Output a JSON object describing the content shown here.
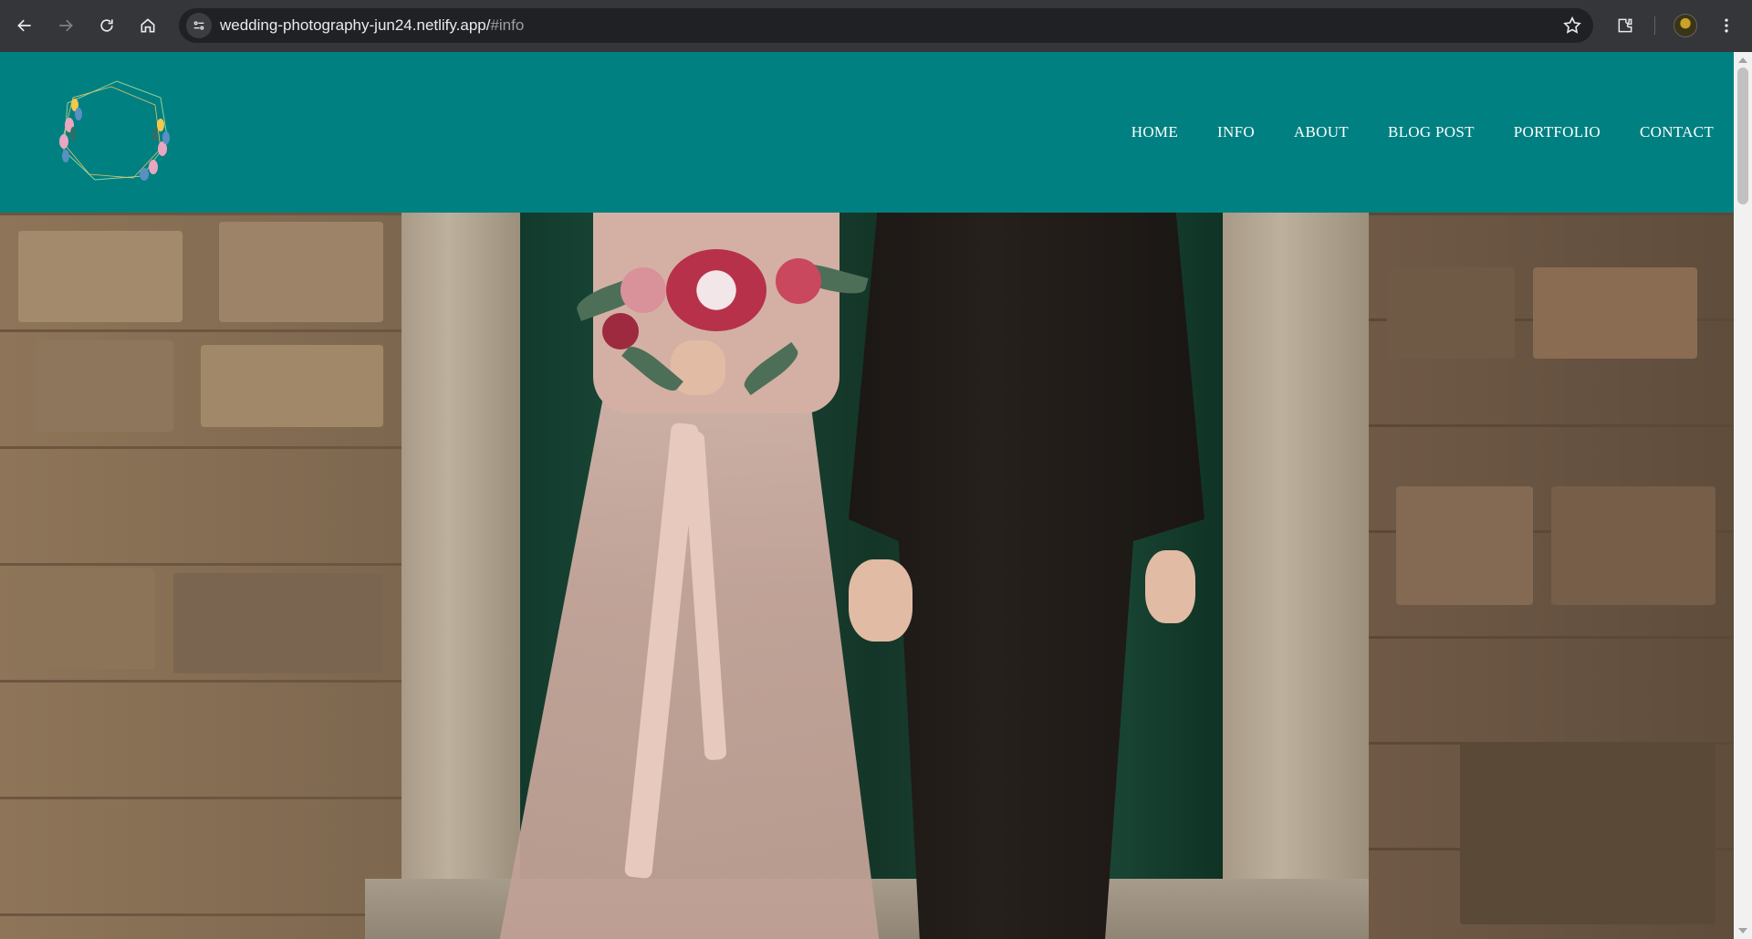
{
  "browser": {
    "url_host": "wedding-photography-jun24.netlify.app/",
    "url_path": "#info",
    "icons": [
      "back-arrow-icon",
      "forward-arrow-icon",
      "reload-icon",
      "home-icon",
      "site-info-icon",
      "bookmark-star-icon",
      "extensions-icon",
      "profile-avatar-icon",
      "kebab-menu-icon"
    ]
  },
  "site": {
    "brand_color": "#018081",
    "logo_icon": "floral-wreath-logo",
    "nav": [
      {
        "label": "HOME"
      },
      {
        "label": "INFO"
      },
      {
        "label": "ABOUT"
      },
      {
        "label": "BLOG POST"
      },
      {
        "label": "PORTFOLIO"
      },
      {
        "label": "CONTACT"
      }
    ]
  }
}
